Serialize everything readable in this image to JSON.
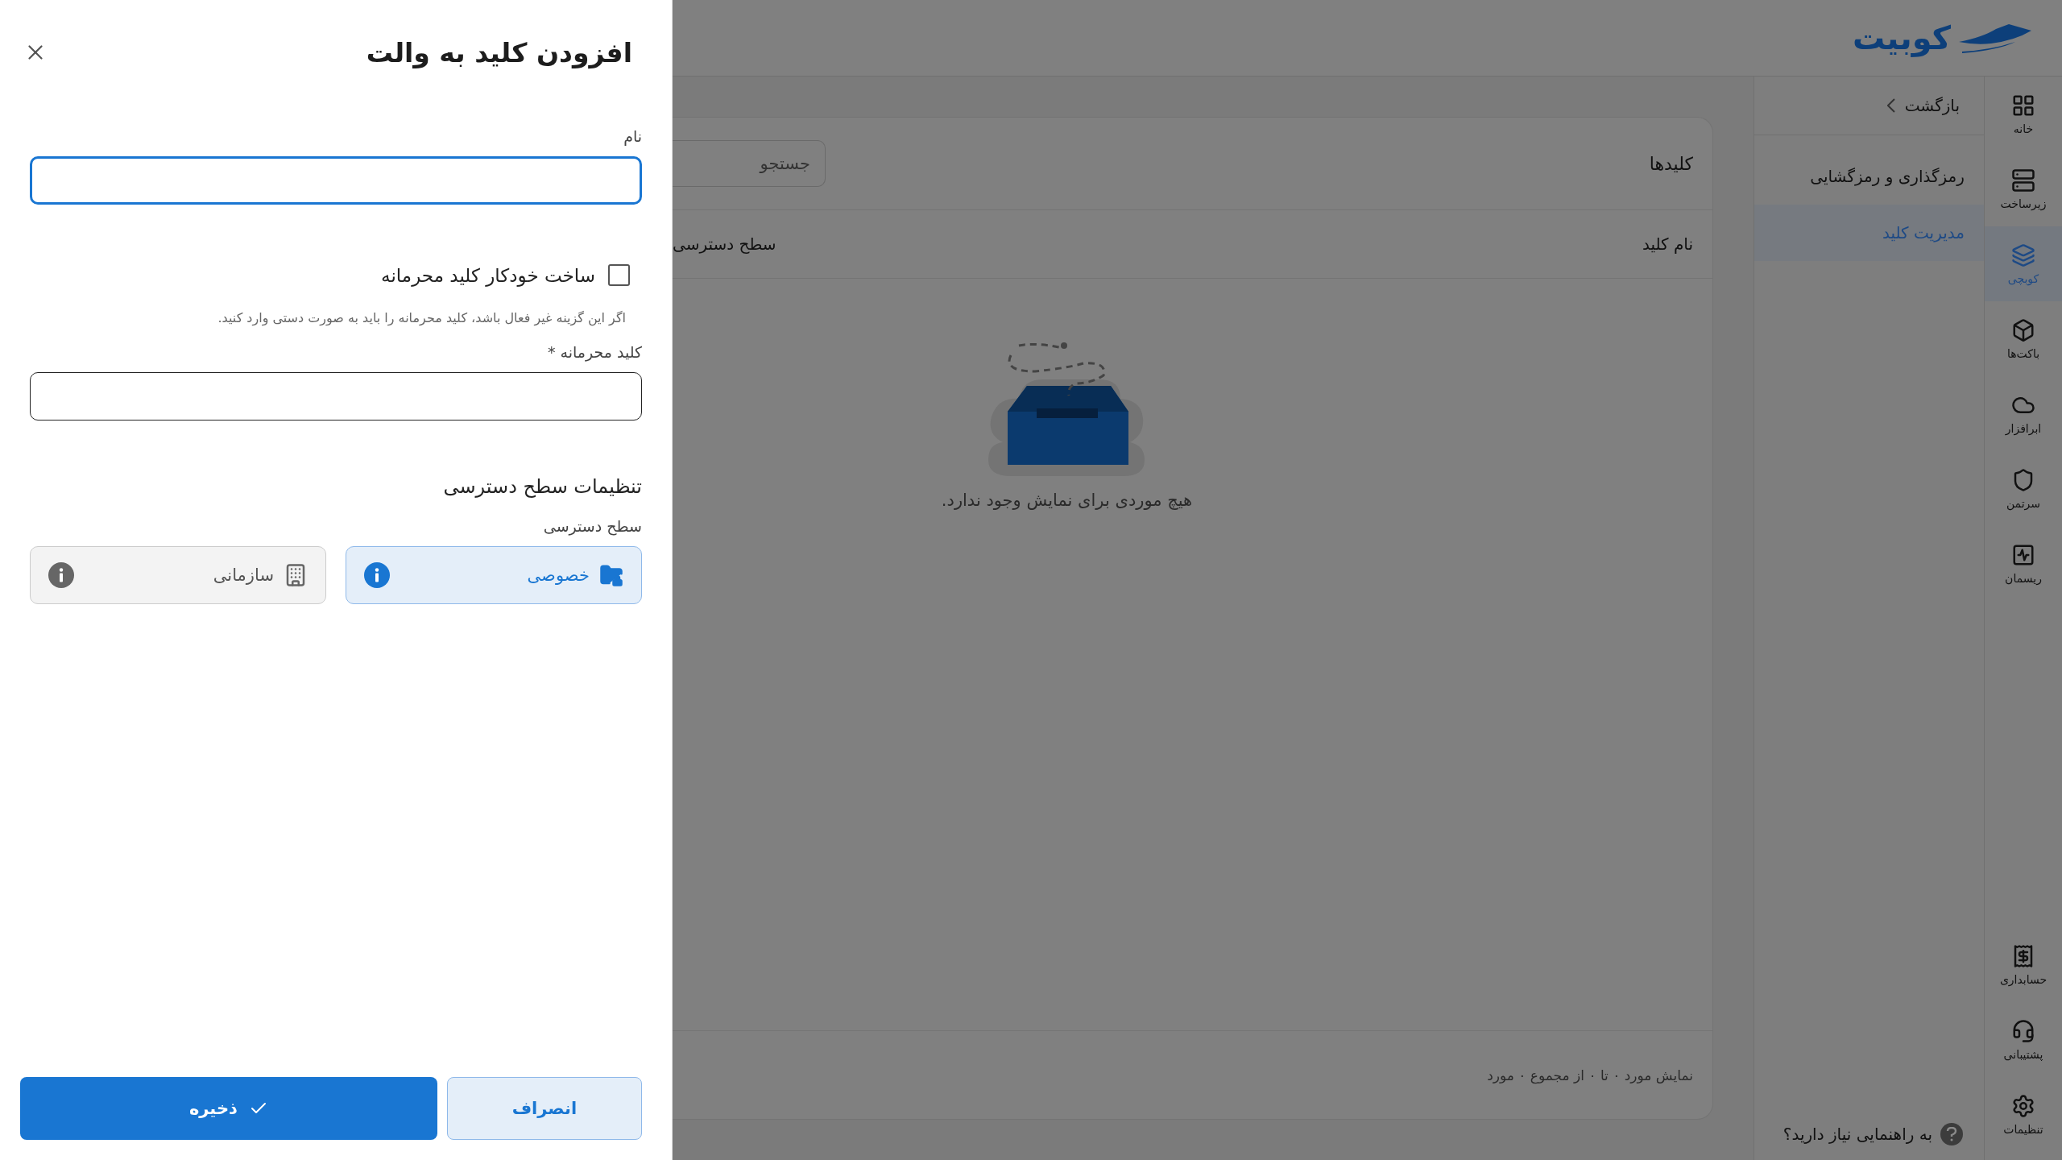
{
  "drawer": {
    "title": "افزودن کلید به والت",
    "name_field": {
      "label": "نام",
      "focused": true
    },
    "auto_generate": {
      "label": "ساخت خودکار کلید محرمانه",
      "checked": false
    },
    "hint": "اگر این گزینه غیر فعال باشد، کلید محرمانه را باید به صورت دستی وارد کنید.",
    "secret_field": {
      "label": "کلید محرمانه *",
      "focused": false
    },
    "section_title": "تنظیمات سطح دسترسی",
    "access_label": "سطح دسترسی",
    "access_options": [
      {
        "label": "خصوصی",
        "kind": "private",
        "selected": true
      },
      {
        "label": "سازمانی",
        "kind": "organization",
        "selected": false
      }
    ],
    "buttons": [
      {
        "label": "انصراف",
        "kind": "secondary"
      },
      {
        "label": "ذخیره",
        "kind": "primary"
      }
    ]
  },
  "app": {
    "logo": "کوبیت",
    "rail": [
      {
        "label": "خانه",
        "kind": "grid",
        "selected": false
      },
      {
        "label": "زیرساخت",
        "kind": "server",
        "selected": false
      },
      {
        "label": "کوبچی",
        "kind": "layers",
        "selected": true
      },
      {
        "label": "باکت‌ها",
        "kind": "box",
        "selected": false
      },
      {
        "label": "ابرافزار",
        "kind": "cloud",
        "selected": false
      },
      {
        "label": "سرتمن",
        "kind": "shield",
        "selected": false
      },
      {
        "label": "ریسمان",
        "kind": "pulse",
        "selected": false
      }
    ],
    "rail_bottom": [
      {
        "label": "حسابداری",
        "kind": "receipt",
        "selected": false
      },
      {
        "label": "پشتیبانی",
        "kind": "support",
        "selected": false
      },
      {
        "label": "تنظیمات",
        "kind": "settings",
        "selected": false
      }
    ],
    "submenu": {
      "back": "بازگشت",
      "items": [
        {
          "label": "رمزگذاری و رمزگشایی",
          "selected": false
        },
        {
          "label": "مدیریت کلید",
          "selected": true
        }
      ]
    },
    "help": "به راهنمایی نیاز دارید؟",
    "card": {
      "title": "کلیدها",
      "search_placeholder": "جستجو",
      "columns": [
        "نام کلید",
        "سطح دسترسی"
      ],
      "empty_text": "هیچ موردی برای نمایش وجود ندارد.",
      "footer": "نمایش مورد ۰ تا ۰ از مجموع ۰ مورد"
    }
  }
}
